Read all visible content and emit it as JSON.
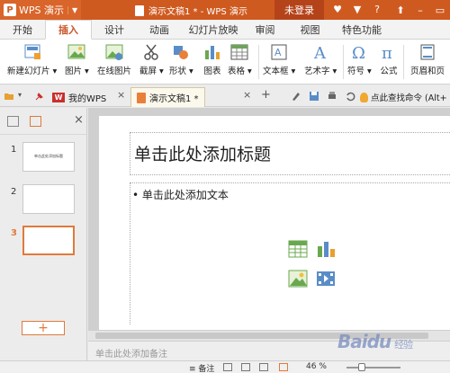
{
  "titlebar": {
    "app_name": "WPS 演示",
    "doc_title": "演示文稿1 * - WPS 演示",
    "login_label": "未登录"
  },
  "tabs": [
    "开始",
    "插入",
    "设计",
    "动画",
    "幻灯片放映",
    "审阅",
    "视图",
    "特色功能"
  ],
  "active_tab": "插入",
  "ribbon": {
    "new_slide": "新建幻灯片",
    "image": "图片",
    "online_image": "在线图片",
    "screenshot": "截屏",
    "shape": "形状",
    "chart": "图表",
    "table": "表格",
    "textbox": "文本框",
    "wordart": "艺术字",
    "symbol": "符号",
    "formula": "公式",
    "header_footer": "页眉和页"
  },
  "doc_tabs": {
    "mywps": "我的WPS",
    "current": "演示文稿1 *",
    "search_cmd": "点此查找命令 (Alt+"
  },
  "slides": [
    {
      "num": "1",
      "title": "单击此处添加标题"
    },
    {
      "num": "2",
      "title": ""
    },
    {
      "num": "3",
      "title": ""
    }
  ],
  "selected_slide": 3,
  "slide": {
    "title_placeholder": "单击此处添加标题",
    "body_placeholder": "• 单击此处添加文本"
  },
  "notes_placeholder": "单击此处添加备注",
  "status": {
    "notes_label": "备注",
    "zoom": "46 %"
  },
  "watermark": {
    "brand": "Baidu",
    "sub": "经验"
  },
  "colors": {
    "accent": "#cf5a20",
    "selection": "#e07a3a"
  }
}
